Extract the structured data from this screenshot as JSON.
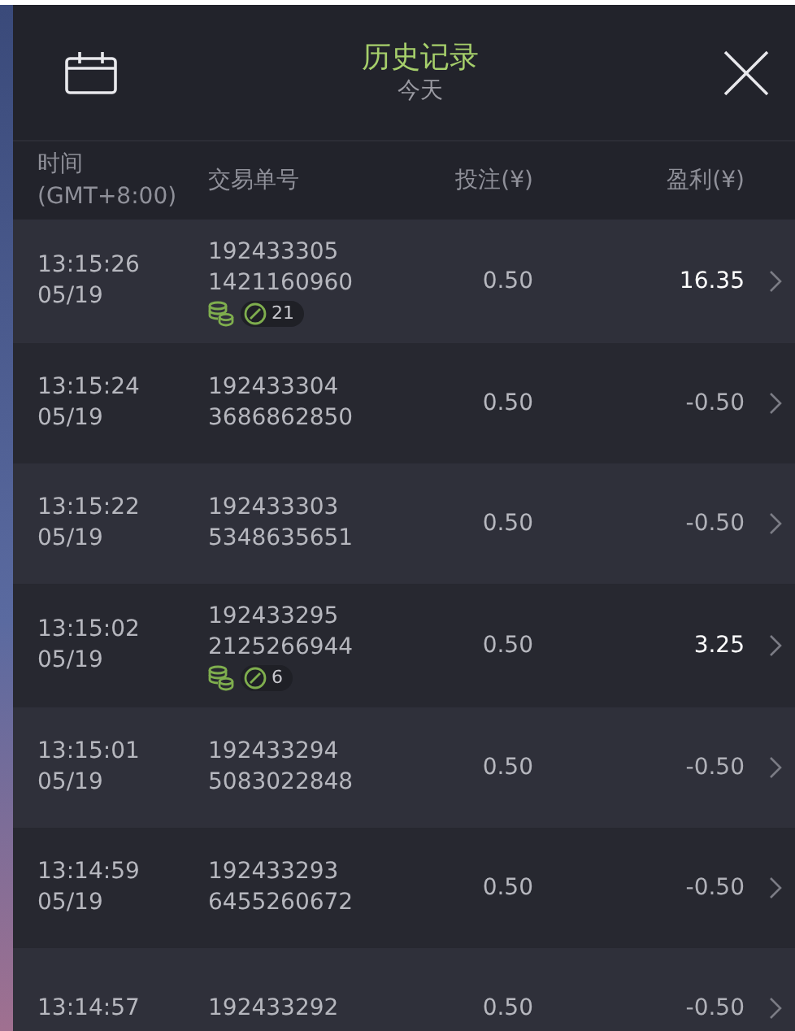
{
  "header": {
    "title": "历史记录",
    "subtitle": "今天"
  },
  "columns": [
    "时间\n(GMT+8:00)",
    "交易单号",
    "投注(¥)",
    "盈利(¥)"
  ],
  "rows": [
    {
      "time": "13:15:26",
      "date": "05/19",
      "id_line_1": "192433305",
      "id_line_2": "1421160960",
      "badge": {
        "count": "21"
      },
      "stake": "0.50",
      "profit": "16.35",
      "win": true
    },
    {
      "time": "13:15:24",
      "date": "05/19",
      "id_line_1": "192433304",
      "id_line_2": "3686862850",
      "stake": "0.50",
      "profit": "-0.50",
      "win": false
    },
    {
      "time": "13:15:22",
      "date": "05/19",
      "id_line_1": "192433303",
      "id_line_2": "5348635651",
      "stake": "0.50",
      "profit": "-0.50",
      "win": false
    },
    {
      "time": "13:15:02",
      "date": "05/19",
      "id_line_1": "192433295",
      "id_line_2": "2125266944",
      "badge": {
        "count": "6"
      },
      "stake": "0.50",
      "profit": "3.25",
      "win": true
    },
    {
      "time": "13:15:01",
      "date": "05/19",
      "id_line_1": "192433294",
      "id_line_2": "5083022848",
      "stake": "0.50",
      "profit": "-0.50",
      "win": false
    },
    {
      "time": "13:14:59",
      "date": "05/19",
      "id_line_1": "192433293",
      "id_line_2": "6455260672",
      "stake": "0.50",
      "profit": "-0.50",
      "win": false
    },
    {
      "time": "13:14:57",
      "id_line_1": "192433292",
      "stake": "0.50",
      "profit": "-0.50",
      "win": false
    }
  ]
}
